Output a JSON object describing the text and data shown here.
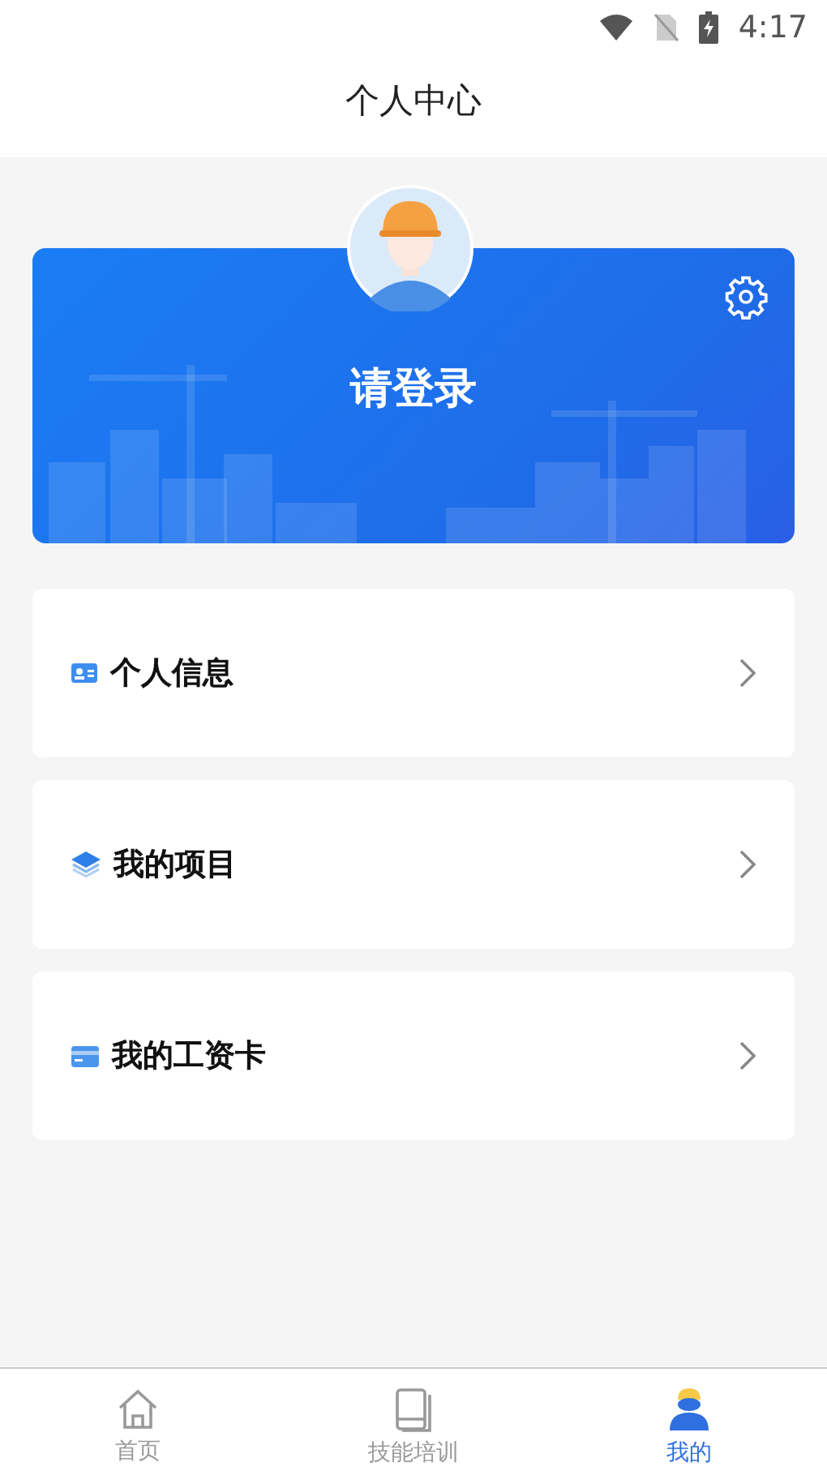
{
  "status_bar": {
    "time": "4:17"
  },
  "header": {
    "title": "个人中心"
  },
  "profile": {
    "login_prompt": "请登录"
  },
  "menu": [
    {
      "kind": "id-card",
      "label": "个人信息"
    },
    {
      "kind": "layers",
      "label": "我的项目"
    },
    {
      "kind": "card",
      "label": "我的工资卡"
    }
  ],
  "tabs": [
    {
      "kind": "home",
      "label": "首页",
      "selected": false
    },
    {
      "kind": "book",
      "label": "技能培训",
      "selected": false
    },
    {
      "kind": "user",
      "label": "我的",
      "selected": true
    }
  ]
}
